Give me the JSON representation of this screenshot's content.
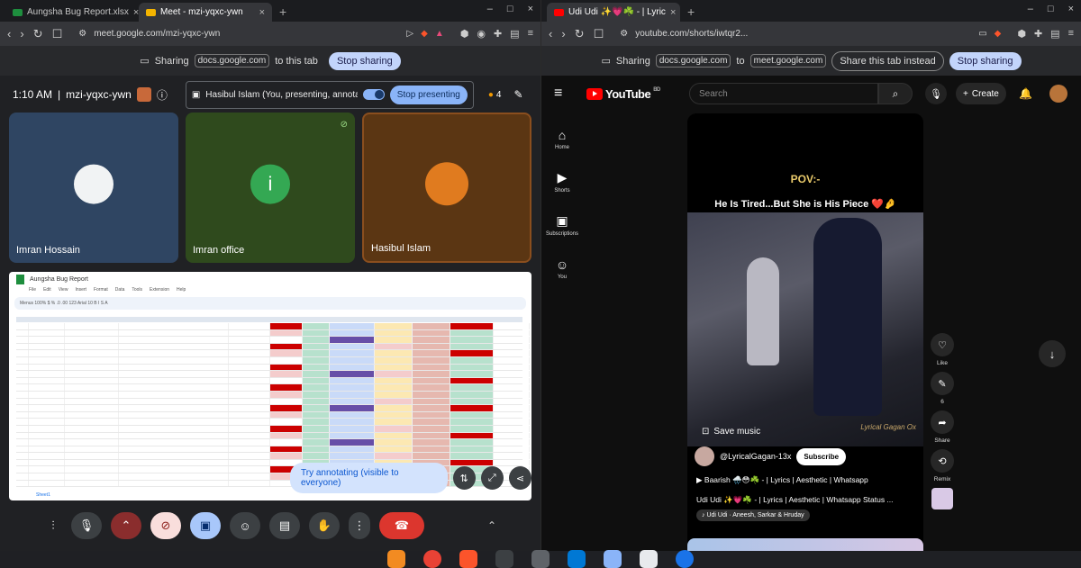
{
  "left_window": {
    "tabs": [
      {
        "title": "Aungsha Bug Report.xlsx",
        "active": false,
        "favicon_color": "#1e8e3e"
      },
      {
        "title": "Meet - mzi-yqxc-ywn",
        "active": true,
        "favicon_color": "#f4b400"
      }
    ],
    "url": "meet.google.com/mzi-yqxc-ywn",
    "share_bar": {
      "sharing_label": "Sharing",
      "shared_site": "docs.google.com",
      "suffix": "to this tab",
      "stop_label": "Stop sharing"
    },
    "meet": {
      "time": "1:10 AM",
      "separator": "|",
      "room": "mzi-yqxc-ywn",
      "presenting_text": "Hasibul Islam (You, presenting, annotati...",
      "stop_presenting": "Stop presenting",
      "participants_count": "4",
      "tiles": [
        {
          "name": "Imran Hossain",
          "bg": "#2f4562",
          "avatar": "#f1f3f4"
        },
        {
          "name": "Imran office",
          "bg": "#2f4a1d",
          "avatar": "#34a853",
          "initial": "i"
        },
        {
          "name": "Hasibul Islam",
          "bg": "#5b3613",
          "avatar": "#e07b1f"
        }
      ],
      "shared_doc": {
        "title": "Aungsha Bug Report",
        "menu": [
          "File",
          "Edit",
          "View",
          "Insert",
          "Format",
          "Data",
          "Tools",
          "Extension",
          "Help"
        ],
        "toolbar_text": "Menus   100%   $   %   .0   .00   123   Arial   10   B   I   S   A",
        "sheet_tab": "Sheet1",
        "status_colors": [
          "#b7e1cd",
          "#c9daf8",
          "#fce8b2",
          "#f4cccc",
          "#674ea7",
          "#cc0000",
          "#e6b8af"
        ]
      },
      "annotate_label": "Try annotating (visible to everyone)"
    }
  },
  "right_window": {
    "tab": {
      "title": "Udi Udi ✨💗☘️ - | Lyric",
      "favicon_color": "#ff0000"
    },
    "url": "youtube.com/shorts/iwtqr2...",
    "share_bar": {
      "sharing_label": "Sharing",
      "shared_site": "docs.google.com",
      "to": "to",
      "target_site": "meet.google.com",
      "share_this_tab": "Share this tab instead",
      "stop_label": "Stop sharing"
    },
    "youtube": {
      "logo": "YouTube",
      "country": "BD",
      "search_placeholder": "Search",
      "create_label": "Create",
      "sidebar": [
        {
          "label": "Home",
          "icon": "⌂"
        },
        {
          "label": "Shorts",
          "icon": "▶"
        },
        {
          "label": "Subscriptions",
          "icon": "▣"
        },
        {
          "label": "You",
          "icon": "☺"
        }
      ],
      "short": {
        "pov": "POV:-",
        "caption": "He Is Tired...But She is His Piece ❤️🤌",
        "watermark": "Lyrical Gagan Ox",
        "save_music": "Save music",
        "channel": "@LyricalGagan-13x",
        "subscribe": "Subscribe",
        "description": "Baarish 🌧️😳☘️ - | Lyrics | Aesthetic | Whatsapp",
        "title": "Udi Udi ✨💗☘️ - | Lyrics | Aesthetic | Whatsapp Status ...",
        "song": "♪ Udi Udi · Aneesh, Sarkar & Hruday"
      },
      "actions": [
        {
          "label": "Like",
          "icon": "♡"
        },
        {
          "label": "6",
          "icon": "✎"
        },
        {
          "label": "Share",
          "icon": "➦"
        },
        {
          "label": "Remix",
          "icon": "⟲"
        }
      ]
    }
  }
}
